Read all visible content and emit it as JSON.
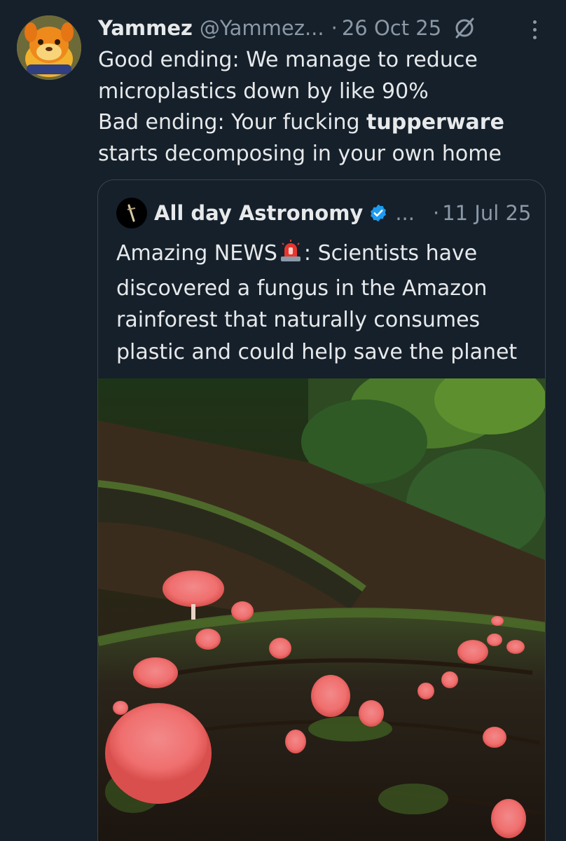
{
  "tweet": {
    "display_name": "Yammez",
    "handle": "@Yammez...",
    "separator": "·",
    "date": "26 Oct 25",
    "text_lines": [
      "Good ending: We manage to reduce",
      "microplastics down by like 90%",
      "Bad ending: Your fucking ",
      "starts decomposing in your own home"
    ],
    "bold_word": "tupperware",
    "avatar_icon": "mascot-avatar",
    "grok_icon": "slashed-circle-icon",
    "more_icon": "vertical-ellipsis-icon"
  },
  "quote": {
    "display_name": "All day Astronomy",
    "verified": true,
    "ellipsis": "...",
    "separator": "·",
    "date": "11 Jul 25",
    "text_lines": [
      "Amazing NEWS",
      ": Scientists have",
      "discovered a fungus in the Amazon",
      "rainforest that naturally consumes",
      "plastic and could help save the planet"
    ],
    "emoji": "police-siren-emoji",
    "image_description_icon": "forest-fungus-photo"
  },
  "colors": {
    "background": "#15202b",
    "text": "#e7e9ea",
    "muted": "#8b98a5",
    "border": "#38444d",
    "verified": "#1d9bf0"
  }
}
